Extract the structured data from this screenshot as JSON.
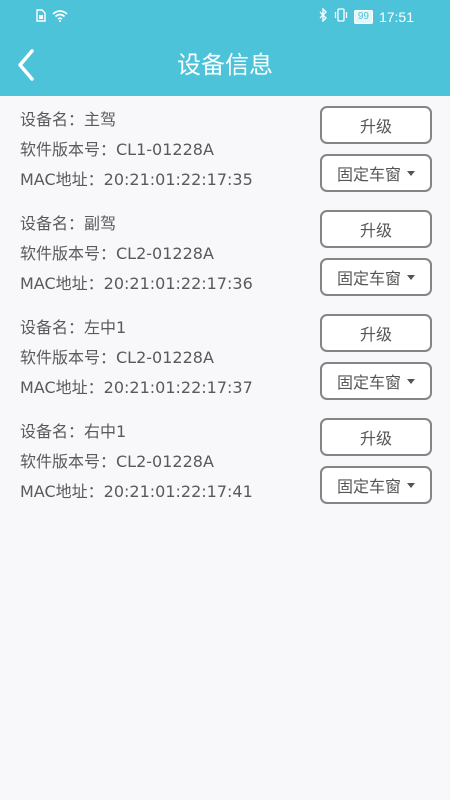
{
  "status": {
    "battery": "99",
    "time": "17:51"
  },
  "header": {
    "title": "设备信息"
  },
  "devices": [
    {
      "name_line": "设备名：主驾",
      "version_line": "软件版本号：CL1-01228A",
      "mac_line": "MAC地址：20:21:01:22:17:35",
      "upgrade_label": "升级",
      "mode_value": "固定车窗"
    },
    {
      "name_line": "设备名：副驾",
      "version_line": "软件版本号：CL2-01228A",
      "mac_line": "MAC地址：20:21:01:22:17:36",
      "upgrade_label": "升级",
      "mode_value": "固定车窗"
    },
    {
      "name_line": "设备名：左中1",
      "version_line": "软件版本号：CL2-01228A",
      "mac_line": "MAC地址：20:21:01:22:17:37",
      "upgrade_label": "升级",
      "mode_value": "固定车窗"
    },
    {
      "name_line": "设备名：右中1",
      "version_line": "软件版本号：CL2-01228A",
      "mac_line": "MAC地址：20:21:01:22:17:41",
      "upgrade_label": "升级",
      "mode_value": "固定车窗"
    }
  ],
  "colors": {
    "header_bg": "#4dc3d9",
    "page_bg": "#f8f7fa"
  },
  "icons": {
    "back": "chevron-left-icon",
    "sim": "sim-icon",
    "wifi": "wifi-icon",
    "bluetooth": "bluetooth-icon",
    "vibrate": "vibrate-icon",
    "dropdown": "caret-down-icon"
  }
}
